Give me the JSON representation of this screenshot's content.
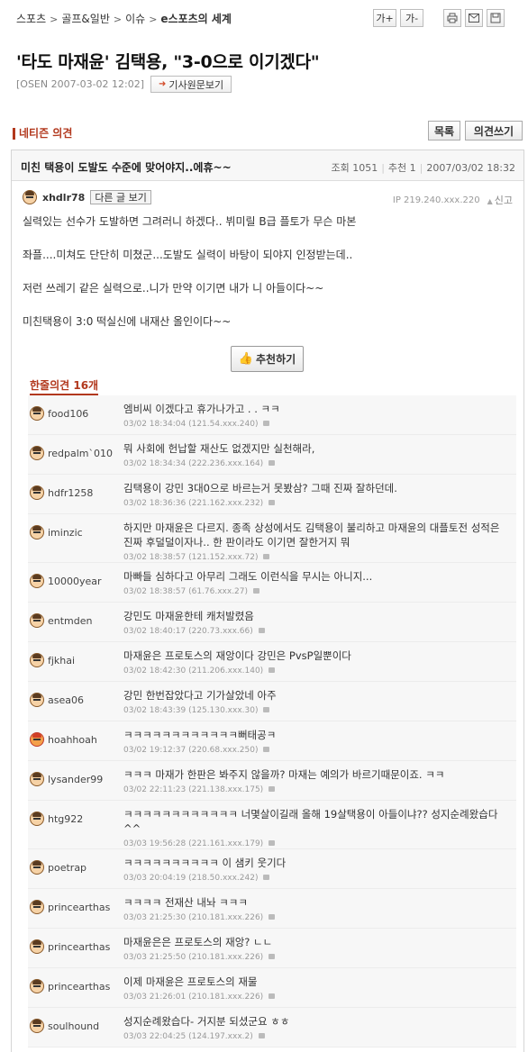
{
  "breadcrumb": [
    "스포츠",
    "골프&일반",
    "이슈",
    "e스포츠의 세계"
  ],
  "tools": {
    "font_up": "가+",
    "font_down": "가-"
  },
  "article": {
    "title": "'타도 마재윤' 김택용, \"3-0으로 이기겠다\"",
    "byline": "[OSEN 2007-03-02 12:02]",
    "original_link": "기사원문보기"
  },
  "section_title": "네티즌 의견",
  "buttons": {
    "list": "목록",
    "write": "의견쓰기",
    "recommend": "추천하기",
    "other_posts": "다른 글 보기"
  },
  "post": {
    "title": "미친 택용이 도발도 수준에 맞어야지..에휴~~",
    "views_label": "조회",
    "views": "1051",
    "recommend_label": "추천",
    "recommend": "1",
    "datetime": "2007/03/02 18:32",
    "author": "xhdlr78",
    "ip": "IP 219.240.xxx.220",
    "report": "신고",
    "body": [
      "실력있는 선수가 도발하면 그려러니 하겠다.. 뷔미릴 B급 플토가 무슨 마본",
      "좌플....미쳐도 단단히 미쳤군...도발도 실력이 바탕이 되야지 인정받는데..",
      "저런 쓰레기 같은 실력으로..니가 만약 이기면 내가 니 아들이다~~",
      "미친택용이 3:0 떡실신에 내재산 올인이다~~"
    ]
  },
  "comments_header": "한줄의견 16개",
  "comments": [
    {
      "user": "food106",
      "text": "엠비씨 이겠다고 휴가나가고 . . ㅋㅋ",
      "meta": "03/02 18:34:04  (121.54.xxx.240)"
    },
    {
      "user": "redpalm`010",
      "text": "뭐 사회에 헌납할 재산도 없겠지만 실천해라,",
      "meta": "03/02 18:34:34  (222.236.xxx.164)"
    },
    {
      "user": "hdfr1258",
      "text": "김택용이 강민 3대0으로 바르는거 못봤삼? 그때 진짜 잘하던데.",
      "meta": "03/02 18:36:36  (221.162.xxx.232)"
    },
    {
      "user": "iminzic",
      "text": "하지만 마재윤은 다르지. 종족 상성에서도 김택용이 불리하고 마재윤의 대플토전 성적은 진짜 후덜덜이자나.. 한 판이라도 이기면 잘한거지 뭐",
      "meta": "03/02 18:38:57  (121.152.xxx.72)",
      "tall": true
    },
    {
      "user": "10000year",
      "text": "마빠들 심하다고 아무리 그래도 이런식을 무시는 아니지...",
      "meta": "03/02 18:38:57  (61.76.xxx.27)"
    },
    {
      "user": "entmden",
      "text": "강민도 마재윤한테 캐처발렸음",
      "meta": "03/02 18:40:17  (220.73.xxx.66)"
    },
    {
      "user": "fjkhai",
      "text": "마재윤은 프로토스의 재앙이다 강민은 PvsP일뿐이다",
      "meta": "03/02 18:42:30  (211.206.xxx.140)"
    },
    {
      "user": "asea06",
      "text": "강민 한번잡았다고 기가살았네 아주",
      "meta": "03/02 18:43:39  (125.130.xxx.30)"
    },
    {
      "user": "hoahhoah",
      "text": "ㅋㅋㅋㅋㅋㅋㅋㅋㅋㅋㅋㅋ뻐태공ㅋ",
      "meta": "03/02 19:12:37  (220.68.xxx.250)",
      "red": true
    },
    {
      "user": "lysander99",
      "text": "ㅋㅋㅋ 마재가 한판은 봐주지 않을까? 마재는 예의가 바르기때문이죠. ㅋㅋ",
      "meta": "03/02 22:11:23  (221.138.xxx.175)"
    },
    {
      "user": "htg922",
      "text": "ㅋㅋㅋㅋㅋㅋㅋㅋㅋㅋㅋㅋ 너몇살이길래 올해 19살택용이 아들이냐?? 성지순례왔습다^^",
      "meta": "03/03 19:56:28  (221.161.xxx.179)",
      "tall": true
    },
    {
      "user": "poetrap",
      "text": "ㅋㅋㅋㅋㅋㅋㅋㅋㅋㅋ 이 샘키 웃기다",
      "meta": "03/03 20:04:19  (218.50.xxx.242)"
    },
    {
      "user": "princearthas",
      "text": "ㅋㅋㅋㅋ 전재산 내놔 ㅋㅋㅋ",
      "meta": "03/03 21:25:30  (210.181.xxx.226)"
    },
    {
      "user": "princearthas",
      "text": "마재윤은은 프로토스의 재앙? ㄴㄴ",
      "meta": "03/03 21:25:50  (210.181.xxx.226)"
    },
    {
      "user": "princearthas",
      "text": "이제 마재윤은 프로토스의 재물",
      "meta": "03/03 21:26:01  (210.181.xxx.226)"
    },
    {
      "user": "soulhound",
      "text": "성지순례왔습다- 거지분 되셨군요 ㅎㅎ",
      "meta": "03/03 22:04:25  (124.197.xxx.2)"
    }
  ]
}
